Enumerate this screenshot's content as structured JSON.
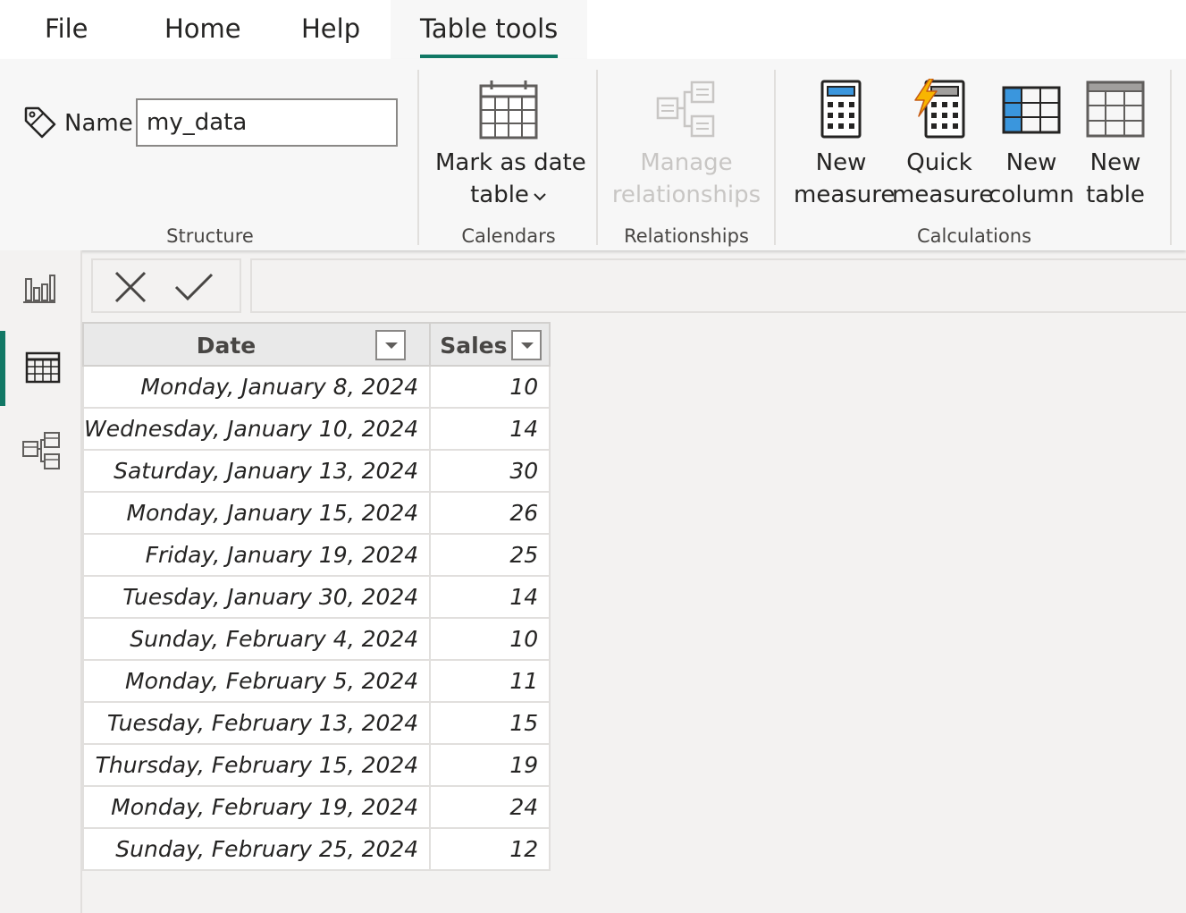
{
  "menu": {
    "file": "File",
    "home": "Home",
    "help": "Help",
    "table_tools": "Table tools"
  },
  "ribbon": {
    "structure": {
      "name_label": "Name",
      "name_value": "my_data",
      "group_label": "Structure"
    },
    "calendars": {
      "mark_as_date_line1": "Mark as date",
      "mark_as_date_line2": "table",
      "group_label": "Calendars"
    },
    "relationships": {
      "manage_line1": "Manage",
      "manage_line2": "relationships",
      "group_label": "Relationships"
    },
    "calculations": {
      "new_measure_line1": "New",
      "new_measure_line2": "measure",
      "quick_measure_line1": "Quick",
      "quick_measure_line2": "measure",
      "new_column_line1": "New",
      "new_column_line2": "column",
      "new_table_line1": "New",
      "new_table_line2": "table",
      "group_label": "Calculations"
    }
  },
  "colors": {
    "accent": "#117865",
    "disabled": "#c8c6c4",
    "calc_blue": "#3a96dd",
    "lightning": "#f8b500"
  },
  "table": {
    "columns": [
      "Date",
      "Sales"
    ],
    "rows": [
      {
        "date": "Monday, January 8, 2024",
        "sales": "10"
      },
      {
        "date": "Wednesday, January 10, 2024",
        "sales": "14"
      },
      {
        "date": "Saturday, January 13, 2024",
        "sales": "30"
      },
      {
        "date": "Monday, January 15, 2024",
        "sales": "26"
      },
      {
        "date": "Friday, January 19, 2024",
        "sales": "25"
      },
      {
        "date": "Tuesday, January 30, 2024",
        "sales": "14"
      },
      {
        "date": "Sunday, February 4, 2024",
        "sales": "10"
      },
      {
        "date": "Monday, February 5, 2024",
        "sales": "11"
      },
      {
        "date": "Tuesday, February 13, 2024",
        "sales": "15"
      },
      {
        "date": "Thursday, February 15, 2024",
        "sales": "19"
      },
      {
        "date": "Monday, February 19, 2024",
        "sales": "24"
      },
      {
        "date": "Sunday, February 25, 2024",
        "sales": "12"
      }
    ]
  }
}
